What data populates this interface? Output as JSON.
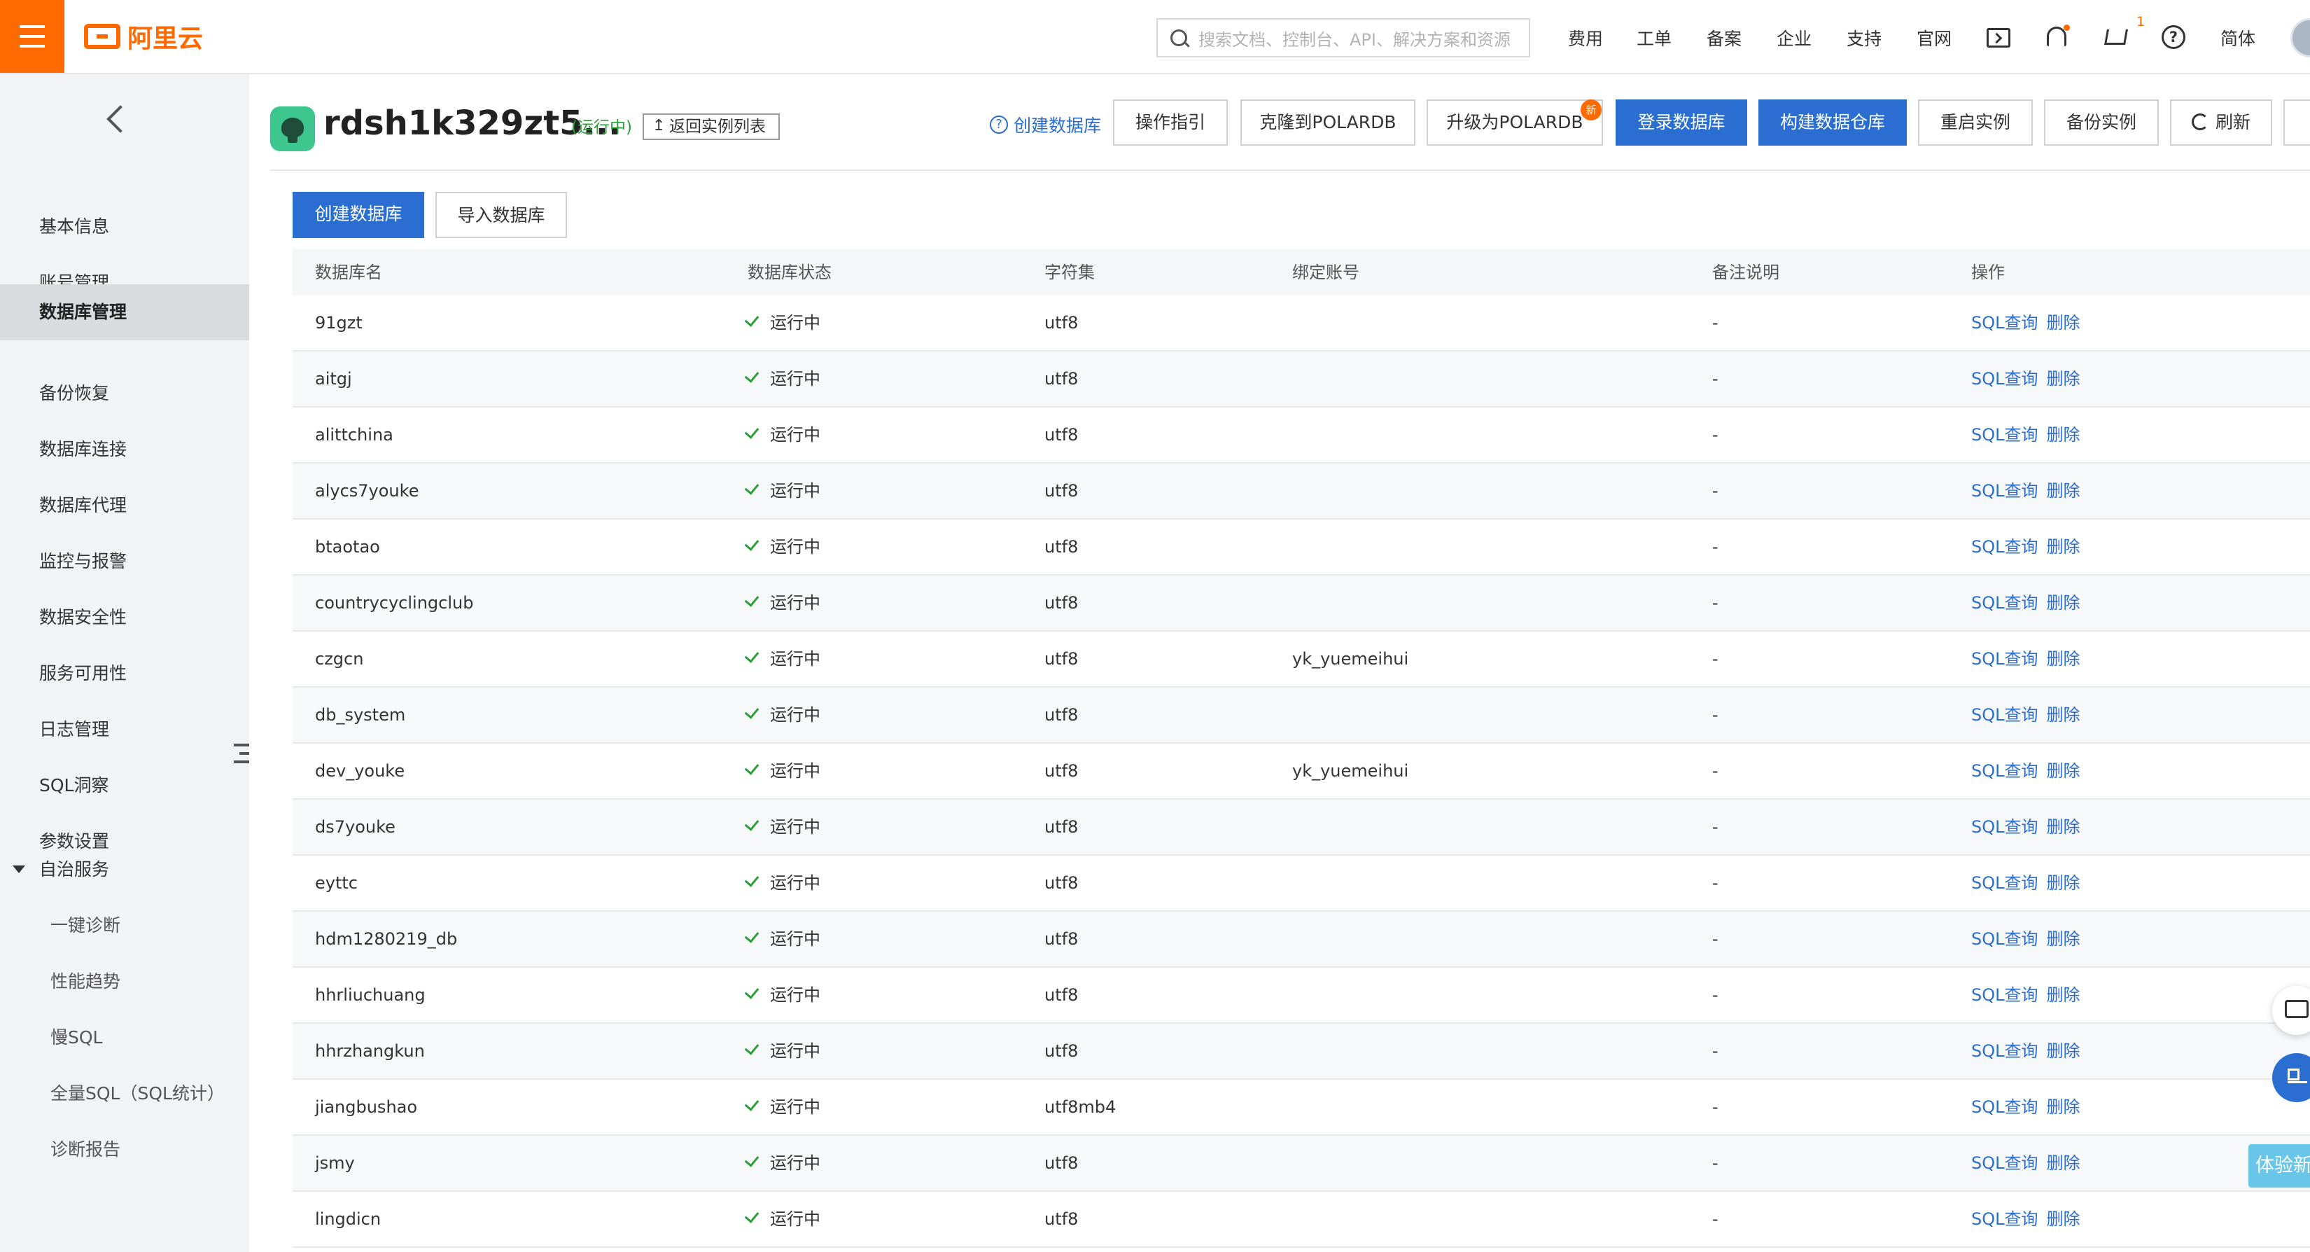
{
  "topbar": {
    "logo_text": "阿里云",
    "search_placeholder": "搜索文档、控制台、API、解决方案和资源",
    "nav": [
      "费用",
      "工单",
      "备案",
      "企业",
      "支持",
      "官网"
    ],
    "cart_count": "1",
    "help_glyph": "?",
    "language": "简体"
  },
  "sidebar": {
    "items": [
      "基本信息",
      "账号管理",
      "数据库管理",
      "备份恢复",
      "数据库连接",
      "数据库代理",
      "监控与报警",
      "数据安全性",
      "服务可用性",
      "日志管理",
      "SQL洞察",
      "参数设置",
      "自治服务"
    ],
    "active_index": 2,
    "sub_items": [
      "一键诊断",
      "性能趋势",
      "慢SQL",
      "全量SQL（SQL统计）",
      "诊断报告"
    ]
  },
  "header": {
    "instance_name": "rdsh1k329zt5...",
    "status": "(运行中)",
    "back_label": "返回实例列表",
    "help_link": "创建数据库",
    "help_glyph": "?",
    "buttons": [
      "操作指引",
      "克隆到POLARDB",
      "升级为POLARDB",
      "登录数据库",
      "构建数据仓库",
      "重启实例",
      "备份实例",
      "刷新"
    ],
    "new_badge": "新"
  },
  "toolbar": {
    "create_label": "创建数据库",
    "import_label": "导入数据库"
  },
  "table": {
    "columns": [
      "数据库名",
      "数据库状态",
      "字符集",
      "绑定账号",
      "备注说明",
      "操作"
    ],
    "actions": [
      "SQL查询",
      "删除"
    ],
    "rows": [
      {
        "name": "91gzt",
        "status": "运行中",
        "charset": "utf8",
        "account": "",
        "note": "-"
      },
      {
        "name": "aitgj",
        "status": "运行中",
        "charset": "utf8",
        "account": "",
        "note": "-"
      },
      {
        "name": "alittchina",
        "status": "运行中",
        "charset": "utf8",
        "account": "",
        "note": "-"
      },
      {
        "name": "alycs7youke",
        "status": "运行中",
        "charset": "utf8",
        "account": "",
        "note": "-"
      },
      {
        "name": "btaotao",
        "status": "运行中",
        "charset": "utf8",
        "account": "",
        "note": "-"
      },
      {
        "name": "countrycyclingclub",
        "status": "运行中",
        "charset": "utf8",
        "account": "",
        "note": "-"
      },
      {
        "name": "czgcn",
        "status": "运行中",
        "charset": "utf8",
        "account": "yk_yuemeihui",
        "note": "-"
      },
      {
        "name": "db_system",
        "status": "运行中",
        "charset": "utf8",
        "account": "",
        "note": "-"
      },
      {
        "name": "dev_youke",
        "status": "运行中",
        "charset": "utf8",
        "account": "yk_yuemeihui",
        "note": "-"
      },
      {
        "name": "ds7youke",
        "status": "运行中",
        "charset": "utf8",
        "account": "",
        "note": "-"
      },
      {
        "name": "eyttc",
        "status": "运行中",
        "charset": "utf8",
        "account": "",
        "note": "-"
      },
      {
        "name": "hdm1280219_db",
        "status": "运行中",
        "charset": "utf8",
        "account": "",
        "note": "-"
      },
      {
        "name": "hhrliuchuang",
        "status": "运行中",
        "charset": "utf8",
        "account": "",
        "note": "-"
      },
      {
        "name": "hhrzhangkun",
        "status": "运行中",
        "charset": "utf8",
        "account": "",
        "note": "-"
      },
      {
        "name": "jiangbushao",
        "status": "运行中",
        "charset": "utf8mb4",
        "account": "",
        "note": "-"
      },
      {
        "name": "jsmy",
        "status": "运行中",
        "charset": "utf8",
        "account": "",
        "note": "-"
      },
      {
        "name": "lingdicn",
        "status": "运行中",
        "charset": "utf8",
        "account": "",
        "note": "-"
      }
    ]
  },
  "floating": {
    "try_new": "体验新"
  }
}
